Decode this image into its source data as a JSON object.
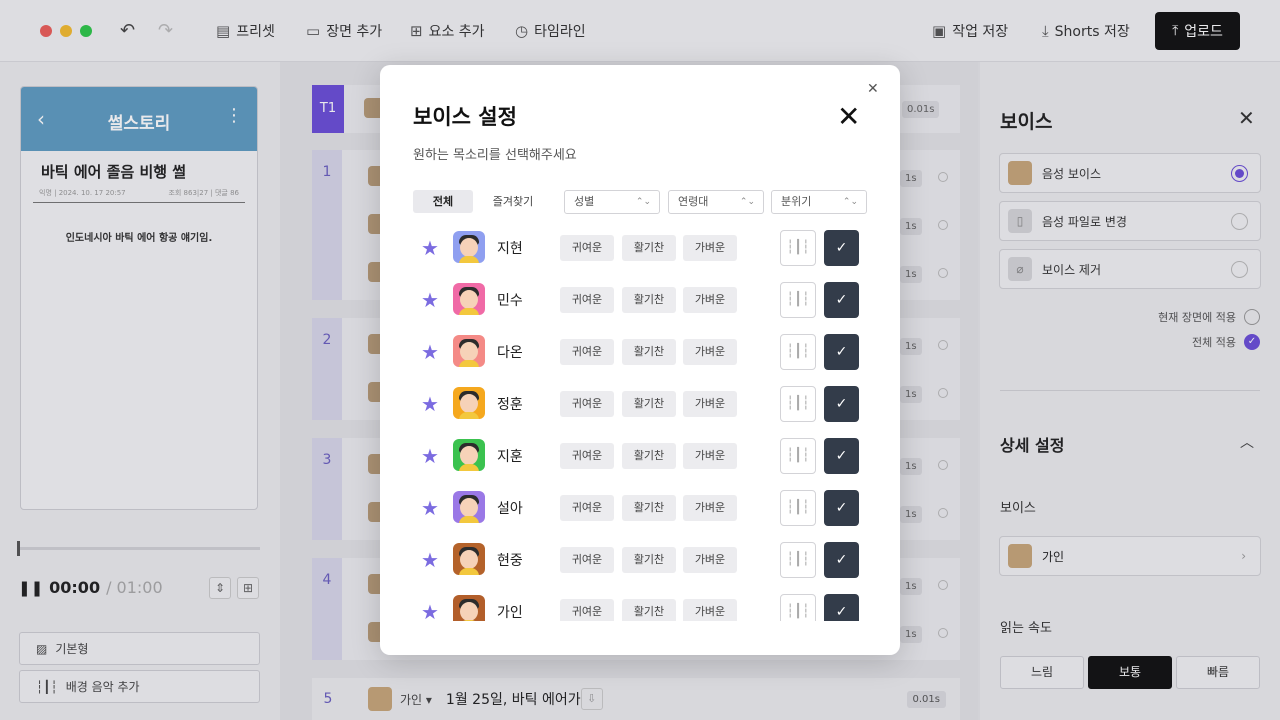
{
  "toolbar": {
    "preset": "프리셋",
    "add_scene": "장면 추가",
    "add_element": "요소 추가",
    "timeline": "타임라인",
    "save_work": "작업 저장",
    "shorts_save": "Shorts 저장",
    "upload": "업로드"
  },
  "preview": {
    "brand": "썰스토리",
    "post_title": "바틱 에어 졸음 비행 썰",
    "meta_left": "익명 | 2024. 10. 17 20:57",
    "meta_right": "조회 863|27 | 댓글 86",
    "body_text": "인도네시아 바틱 에어 항공 얘기임.",
    "time_current": "00:00",
    "time_total": "/ 01:00",
    "btn_basic": "기본형",
    "btn_bgm": "배경 음악 추가"
  },
  "scenes": {
    "t1": "T1",
    "nums": [
      "1",
      "2",
      "3",
      "4"
    ],
    "row5": {
      "num": "5",
      "voice": "가인 ▾",
      "text": "1월 25일, 바틱 에어가",
      "duration": "0.01s"
    },
    "dur": "0.01s",
    "dur_short": "1s"
  },
  "modal": {
    "title": "보이스 설정",
    "subtitle": "원하는 목소리를 선택해주세요",
    "tab_all": "전체",
    "tab_fav": "즐겨찾기",
    "filters": [
      "성별",
      "연령대",
      "분위기"
    ],
    "tags": [
      "귀여운",
      "활기찬",
      "가벼운"
    ],
    "voices": [
      {
        "name": "지현",
        "bg": "#8f9ff0"
      },
      {
        "name": "민수",
        "bg": "#f06aa6"
      },
      {
        "name": "다온",
        "bg": "#f48a86"
      },
      {
        "name": "정훈",
        "bg": "#f5a81e"
      },
      {
        "name": "지훈",
        "bg": "#3bc24f"
      },
      {
        "name": "설아",
        "bg": "#9a78e6"
      },
      {
        "name": "현중",
        "bg": "#b4622a"
      },
      {
        "name": "가인",
        "bg": "#b25e2a"
      }
    ]
  },
  "panel": {
    "title": "보이스",
    "opt_voice": "음성 보이스",
    "opt_file": "음성 파일로 변경",
    "opt_remove": "보이스 제거",
    "apply_current": "현재 장면에 적용",
    "apply_all": "전체 적용",
    "detail": "상세 설정",
    "voice_label": "보이스",
    "voice_value": "가인",
    "speed_label": "읽는 속도",
    "speed_slow": "느림",
    "speed_normal": "보통",
    "speed_fast": "빠름"
  },
  "colors": {
    "accent": "#6b4fd8",
    "dark_button": "#333c4a"
  }
}
